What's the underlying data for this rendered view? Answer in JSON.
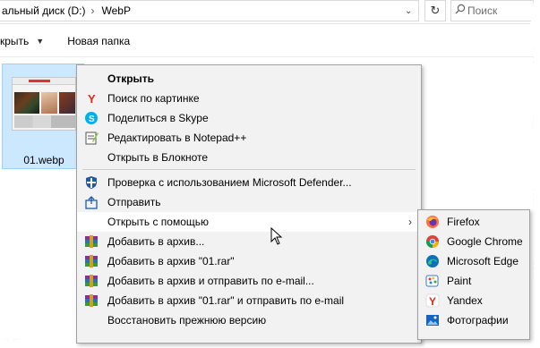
{
  "address": {
    "path_part1": "альный диск (D:)",
    "separator": "›",
    "path_part2": "WebP",
    "dropdown_glyph": "⌄",
    "refresh_glyph": "↻",
    "search_placeholder": "Поиск"
  },
  "command_bar": {
    "open_label": "крыть",
    "open_caret": "▼",
    "new_folder_label": "Новая папка"
  },
  "file": {
    "name": "01.webp"
  },
  "context_menu": {
    "items": [
      {
        "label": "Открыть",
        "icon": "none"
      },
      {
        "label": "Поиск по картинке",
        "icon": "yandex-icon"
      },
      {
        "label": "Поделиться в Skype",
        "icon": "skype-icon"
      },
      {
        "label": "Редактировать в Notepad++",
        "icon": "notepad-plus-plus-icon"
      },
      {
        "label": "Открыть в Блокноте",
        "icon": "none"
      },
      {
        "label": "Проверка с использованием Microsoft Defender...",
        "icon": "defender-icon"
      },
      {
        "label": "Отправить",
        "icon": "share-icon"
      },
      {
        "label": "Открыть с помощью",
        "icon": "none",
        "arrow": "›"
      },
      {
        "label": "Добавить в архив...",
        "icon": "winrar-icon"
      },
      {
        "label": "Добавить в архив \"01.rar\"",
        "icon": "winrar-icon"
      },
      {
        "label": "Добавить в архив и отправить по e-mail...",
        "icon": "winrar-icon"
      },
      {
        "label": "Добавить в архив \"01.rar\" и отправить по e-mail",
        "icon": "winrar-icon"
      },
      {
        "label": "Восстановить прежнюю версию",
        "icon": "none"
      }
    ]
  },
  "open_with_submenu": {
    "items": [
      {
        "label": "Firefox",
        "icon": "firefox-icon"
      },
      {
        "label": "Google Chrome",
        "icon": "chrome-icon"
      },
      {
        "label": "Microsoft Edge",
        "icon": "edge-icon"
      },
      {
        "label": "Paint",
        "icon": "paint-icon"
      },
      {
        "label": "Yandex",
        "icon": "yandex-browser-icon"
      },
      {
        "label": "Фотографии",
        "icon": "photos-icon"
      }
    ]
  },
  "colors": {
    "selection_fill": "#cce8ff",
    "selection_border": "#99d1ff",
    "menu_bg": "#f2f2f2",
    "menu_hover": "#ffffff"
  }
}
